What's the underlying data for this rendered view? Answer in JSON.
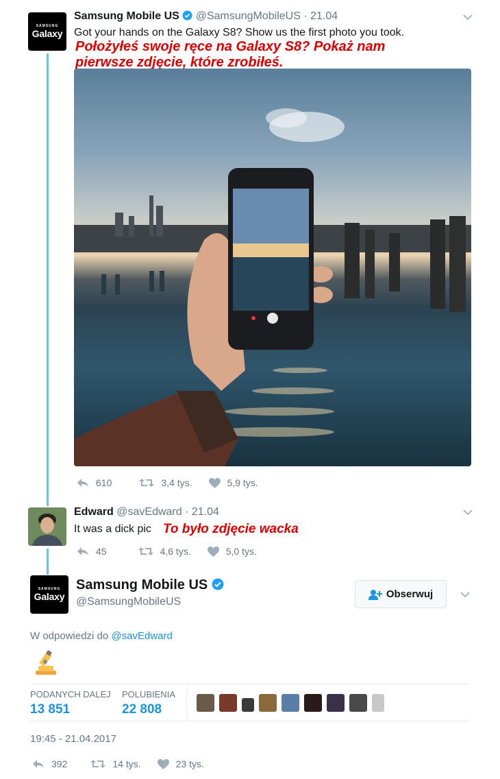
{
  "tweet1": {
    "logo_small": "SAMSUNG",
    "logo_big": "Galaxy",
    "name": "Samsung Mobile US",
    "handle_date": "@SamsungMobileUS · 21.04",
    "text": "Got your hands on the Galaxy S8? Show us the first photo you took.",
    "translation_line1": "Położyłeś swoje ręce na Galaxy S8? Pokaż nam",
    "translation_line2": "pierwsze zdjęcie, które zrobiłeś.",
    "replies": "610",
    "retweets": "3,4 tys.",
    "likes": "5,9 tys."
  },
  "tweet2": {
    "name": "Edward",
    "handle_date": "@savEdward · 21.04",
    "text": "It was a dick pic",
    "translation": "To było zdjęcie wacka",
    "replies": "45",
    "retweets": "4,6 tys.",
    "likes": "5,0 tys."
  },
  "tweet3": {
    "logo_small": "SAMSUNG",
    "logo_big": "Galaxy",
    "name": "Samsung Mobile US",
    "handle": "@SamsungMobileUS",
    "follow_label": "Obserwuj",
    "reply_prefix": "W odpowiedzi do",
    "reply_to": "@savEdward",
    "emoji": "microscope-emoji",
    "stats": {
      "retweets_label": "PODANYCH DALEJ",
      "retweets_value": "13 851",
      "likes_label": "POLUBIENIA",
      "likes_value": "22 808"
    },
    "timestamp": "19:45 - 21.04.2017",
    "replies": "392",
    "retweets": "14 tys.",
    "likes": "23 tys."
  },
  "colors": {
    "accent": "#1b95e0",
    "thread_line": "#6cc3dc",
    "translation": "#e00000",
    "muted": "#657786"
  }
}
